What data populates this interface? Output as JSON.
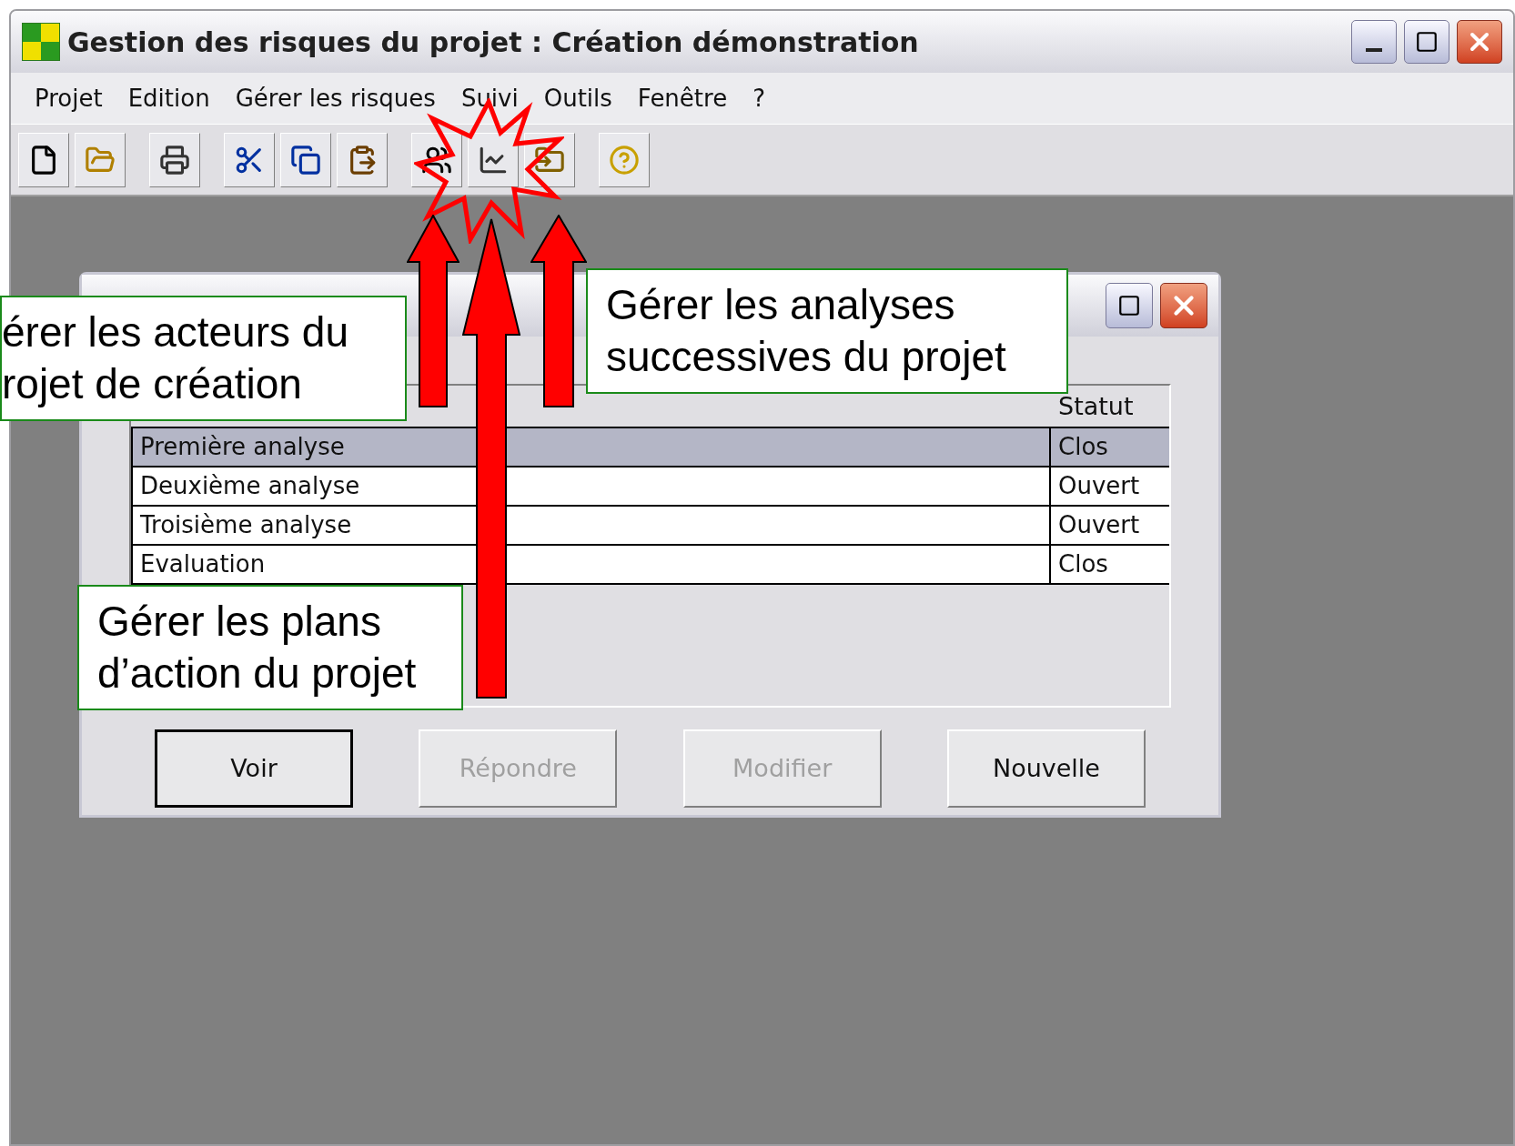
{
  "window": {
    "title": "Gestion des risques du projet : Création démonstration"
  },
  "menu": [
    "Projet",
    "Edition",
    "Gérer les risques",
    "Suivi",
    "Outils",
    "Fenêtre",
    "?"
  ],
  "analyses_window": {
    "status_header": "Statut",
    "rows": [
      {
        "name": "Première analyse",
        "status": "Clos",
        "selected": true
      },
      {
        "name": "Deuxième analyse",
        "status": "Ouvert",
        "selected": false
      },
      {
        "name": "Troisième analyse",
        "status": "Ouvert",
        "selected": false
      },
      {
        "name": "Evaluation",
        "status": "Clos",
        "selected": false
      }
    ],
    "buttons": [
      {
        "label": "Voir",
        "disabled": false,
        "default": true
      },
      {
        "label": "Répondre",
        "disabled": true,
        "default": false
      },
      {
        "label": "Modifier",
        "disabled": true,
        "default": false
      },
      {
        "label": "Nouvelle",
        "disabled": false,
        "default": false
      }
    ]
  },
  "callouts": [
    {
      "text": "érer les acteurs du\nrojet de création"
    },
    {
      "text": "Gérer les analyses\nsuccessives du projet"
    },
    {
      "text": "Gérer les plans\nd’action du projet"
    }
  ]
}
